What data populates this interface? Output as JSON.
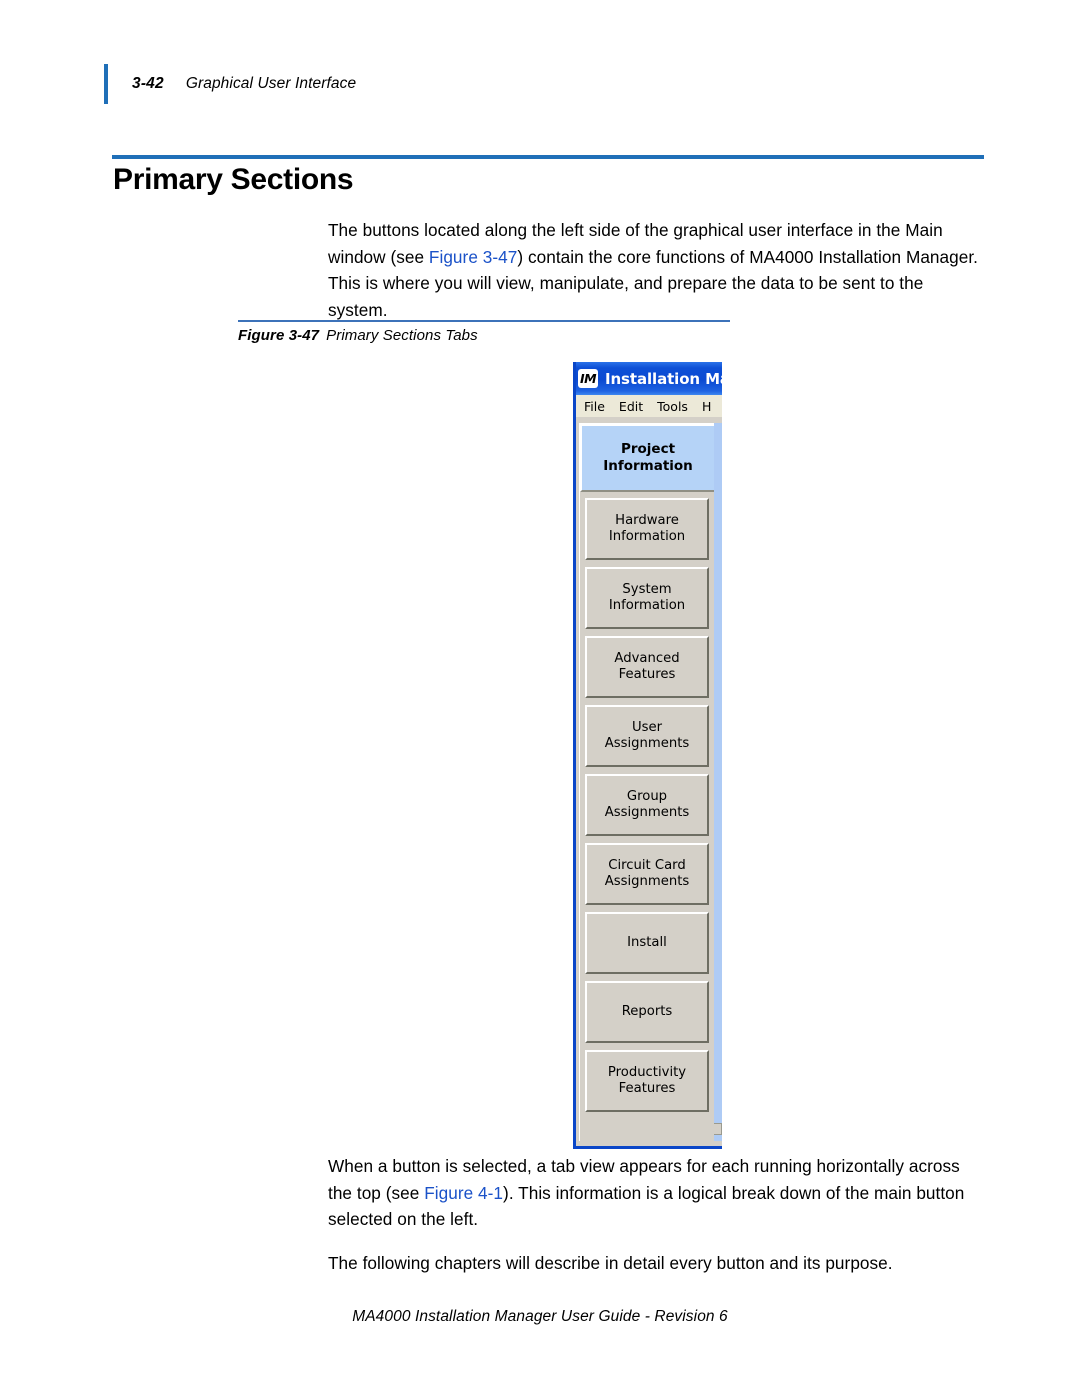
{
  "header": {
    "page_number": "3-42",
    "chapter_title": "Graphical User Interface",
    "accent_color": "#1F6FB8"
  },
  "heading": {
    "title": "Primary Sections",
    "rule_color": "#1F6FB8"
  },
  "intro": {
    "paragraph_prefix": "The buttons located along the left side of the graphical user interface in the Main window (see ",
    "xref": "Figure 3-47",
    "paragraph_suffix": ") contain the core functions of MA4000 Installation Manager. This is where you will view, manipulate, and prepare the data to be sent to the system."
  },
  "figure": {
    "caption_label": "Figure 3-47",
    "caption_text": "Primary Sections Tabs",
    "rule_color": "#3C72B9"
  },
  "app": {
    "icon_label": "IM",
    "icon_name": "installation-manager-icon",
    "title": "Installation Ma",
    "titlebar_color": "#0B4AD2",
    "menubar_color": "#ECE9D8",
    "menu": [
      {
        "label": "File"
      },
      {
        "label": "Edit"
      },
      {
        "label": "Tools"
      },
      {
        "label": "H"
      }
    ],
    "selected_tab": {
      "line1": "Project",
      "line2": "Information",
      "highlight_color": "#B5D3F7"
    },
    "tabs": [
      {
        "line1": "Hardware",
        "line2": "Information"
      },
      {
        "line1": "System",
        "line2": "Information"
      },
      {
        "line1": "Advanced",
        "line2": "Features"
      },
      {
        "line1": "User",
        "line2": "Assignments"
      },
      {
        "line1": "Group",
        "line2": "Assignments"
      },
      {
        "line1": "Circuit Card",
        "line2": "Assignments"
      },
      {
        "line1": "Install",
        "line2": ""
      },
      {
        "line1": "Reports",
        "line2": ""
      },
      {
        "line1": "Productivity",
        "line2": "Features"
      }
    ]
  },
  "outro": {
    "paragraph1_prefix": "When a button is selected, a tab view appears for each running horizontally across the top (see ",
    "paragraph1_xref": "Figure 4-1",
    "paragraph1_suffix": "). This information is a logical break down of the main button selected on the left.",
    "paragraph2": "The following chapters will describe in detail every button and its purpose."
  },
  "footer": {
    "text": "MA4000 Installation Manager User Guide - Revision 6"
  }
}
